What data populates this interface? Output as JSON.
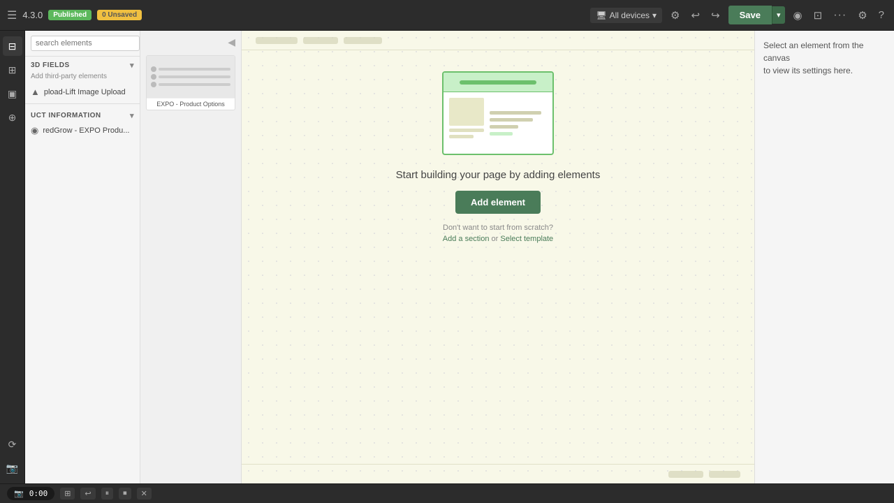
{
  "topbar": {
    "version": "4.3.0",
    "badge_published": "Published",
    "badge_unsaved": "0 Unsaved",
    "device_selector": "All devices",
    "save_label": "Save",
    "more_label": "···"
  },
  "left_panel": {
    "search_placeholder": "search elements",
    "section_3d_fields": "3D FIELDS",
    "third_party_note": "Add third-party elements",
    "item_image_upload": "pload-Lift Image Upload",
    "section_product_info": "UCT INFORMATION",
    "item_product": "redGrow - EXPO Produ..."
  },
  "thumbnail_panel": {
    "card1_label": "EXPO - Product Options"
  },
  "canvas": {
    "prompt": "Start building your page by adding elements",
    "add_element_btn": "Add element",
    "scratch_text": "Don't want to start from scratch?",
    "add_section_link": "Add a section",
    "or_text": "or",
    "select_template_link": "Select template"
  },
  "right_panel": {
    "note_line1": "Select an element from the canvas",
    "note_line2": "to view its settings here."
  },
  "bottom_bar": {
    "time": "0:00",
    "camera_icon": "📷"
  },
  "icons": {
    "hamburger": "☰",
    "layers": "⊟",
    "elements": "⊞",
    "media": "▣",
    "apps": "⊕",
    "history": "⟳",
    "undo": "↩",
    "redo": "↪",
    "preview": "◉",
    "responsive": "⊡",
    "settings": "⚙",
    "help": "?",
    "more": "···",
    "chevron_down": "▾",
    "gear": "⚙",
    "expand": "▾",
    "play_pause": "⏸",
    "delete": "✕",
    "grid": "⊞",
    "stop": "⏹"
  }
}
